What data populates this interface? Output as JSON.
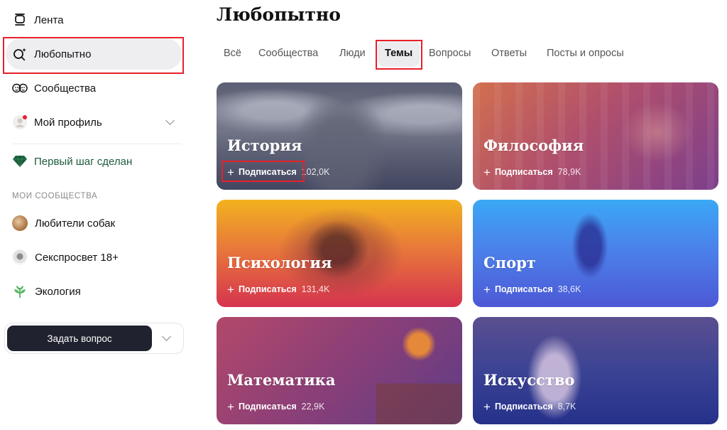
{
  "sidebar": {
    "nav": [
      {
        "label": "Лента",
        "icon": "feed-icon"
      },
      {
        "label": "Любопытно",
        "icon": "sparkle-search-icon"
      },
      {
        "label": "Сообщества",
        "icon": "communities-icon"
      },
      {
        "label": "Мой профиль",
        "icon": "profile-avatar-icon"
      },
      {
        "label": "Первый шаг сделан",
        "icon": "diamond-icon"
      }
    ],
    "section_title": "МОИ СООБЩЕСТВА",
    "communities": [
      {
        "label": "Любители собак"
      },
      {
        "label": "Секспросвет 18+"
      },
      {
        "label": "Экология"
      }
    ],
    "ask_button": "Задать вопрос"
  },
  "main": {
    "title": "Любопытно",
    "tabs": [
      {
        "label": "Всё"
      },
      {
        "label": "Сообщества"
      },
      {
        "label": "Люди"
      },
      {
        "label": "Темы"
      },
      {
        "label": "Вопросы"
      },
      {
        "label": "Ответы"
      },
      {
        "label": "Посты и опросы"
      }
    ],
    "active_tab": "Темы",
    "cards": [
      {
        "title": "История",
        "subscribe": "Подписаться",
        "count": "102,0K",
        "color": "#454a66"
      },
      {
        "title": "Философия",
        "subscribe": "Подписаться",
        "count": "78,9K",
        "color": "#a04a7c"
      },
      {
        "title": "Психология",
        "subscribe": "Подписаться",
        "count": "131,4K",
        "color": "#d7344f"
      },
      {
        "title": "Спорт",
        "subscribe": "Подписаться",
        "count": "38,6K",
        "color": "#3f74e8"
      },
      {
        "title": "Математика",
        "subscribe": "Подписаться",
        "count": "22,9K",
        "color": "#9a3a6e"
      },
      {
        "title": "Искусство",
        "subscribe": "Подписаться",
        "count": "8,7K",
        "color": "#2f3a8c"
      }
    ]
  },
  "colors": {
    "highlight": "#e8202a",
    "active_bg": "#eeeef0",
    "ask_button_bg": "#20232f",
    "first_step_green": "#1c5b3a"
  }
}
